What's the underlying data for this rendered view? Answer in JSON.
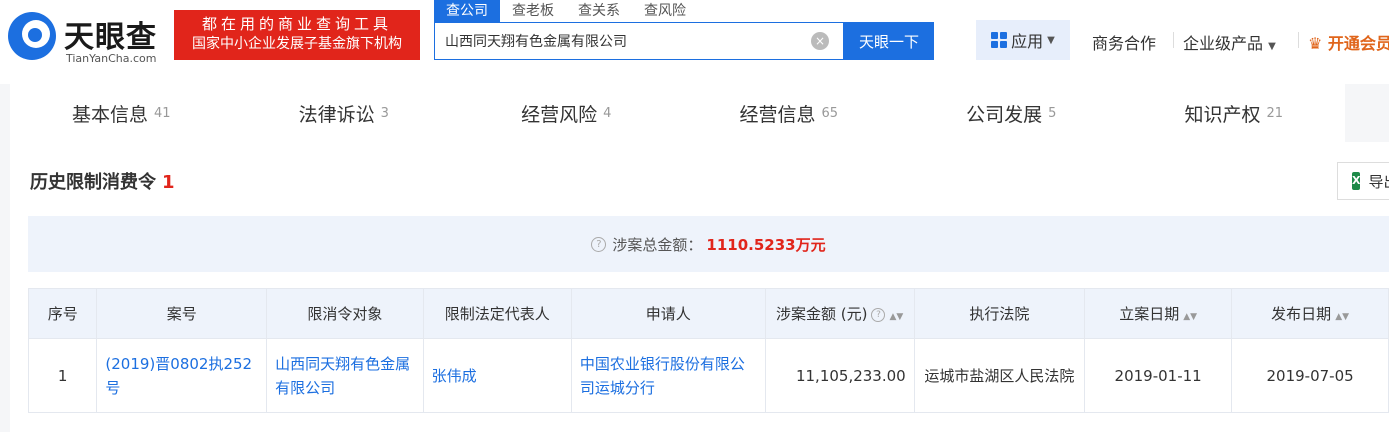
{
  "brand": {
    "name": "天眼查",
    "sub": "TianYanCha.com",
    "slogan_line1": "都在用的商业查询工具",
    "slogan_line2": "国家中小企业发展子基金旗下机构"
  },
  "search": {
    "tabs": [
      "查公司",
      "查老板",
      "查关系",
      "查风险"
    ],
    "value": "山西同天翔有色金属有限公司",
    "clear_icon": "×",
    "button": "天眼一下"
  },
  "nav": {
    "apps": "应用",
    "business": "商务合作",
    "enterprise": "企业级产品",
    "vip": "开通会员",
    "crown_icon": "♛"
  },
  "main_tabs": [
    {
      "label": "基本信息",
      "count": "41"
    },
    {
      "label": "法律诉讼",
      "count": "3"
    },
    {
      "label": "经营风险",
      "count": "4"
    },
    {
      "label": "经营信息",
      "count": "65"
    },
    {
      "label": "公司发展",
      "count": "5"
    },
    {
      "label": "知识产权",
      "count": "21"
    }
  ],
  "section": {
    "title": "历史限制消费令",
    "count": "1",
    "export_label": "导出",
    "summary_label": "涉案总金额：",
    "summary_value": "1110.5233万元"
  },
  "table": {
    "headers": [
      "序号",
      "案号",
      "限消令对象",
      "限制法定代表人",
      "申请人",
      "涉案金额 (元)",
      "执行法院",
      "立案日期",
      "发布日期"
    ],
    "rows": [
      {
        "index": "1",
        "case_no": "(2019)晋0802执252号",
        "target": "山西同天翔有色金属有限公司",
        "legal_rep": "张伟成",
        "applicant": "中国农业银行股份有限公司运城分行",
        "amount": "11,105,233.00",
        "court": "运城市盐湖区人民法院",
        "filing_date": "2019-01-11",
        "publish_date": "2019-07-05"
      }
    ]
  },
  "colors": {
    "brand_blue": "#1c6fe0",
    "accent_red": "#e1251b",
    "vip_orange": "#e0651b"
  }
}
